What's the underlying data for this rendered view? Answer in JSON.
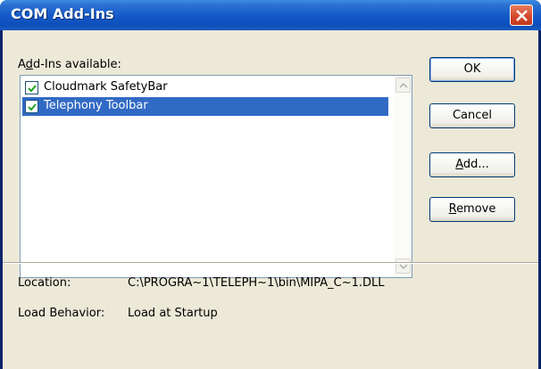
{
  "window": {
    "title": "COM Add-Ins"
  },
  "addins": {
    "label_pre": "A",
    "label_accel": "d",
    "label_post": "d-Ins available:",
    "items": [
      {
        "label": "Cloudmark SafetyBar",
        "checked": true,
        "selected": false
      },
      {
        "label": "Telephony Toolbar",
        "checked": true,
        "selected": true
      }
    ]
  },
  "buttons": {
    "ok": "OK",
    "cancel": "Cancel",
    "add_accel": "A",
    "add_rest": "dd...",
    "remove_accel": "R",
    "remove_rest": "emove"
  },
  "info": {
    "location_label": "Location:",
    "location_value": "C:\\PROGRA~1\\TELEPH~1\\bin\\MIPA_C~1.DLL",
    "load_behavior_label": "Load Behavior:",
    "load_behavior_value": "Load at Startup"
  },
  "colors": {
    "selection": "#316ac5",
    "dialog_bg": "#ece9d8",
    "titlebar": "#0d4fb9",
    "close_button": "#d1462a"
  }
}
